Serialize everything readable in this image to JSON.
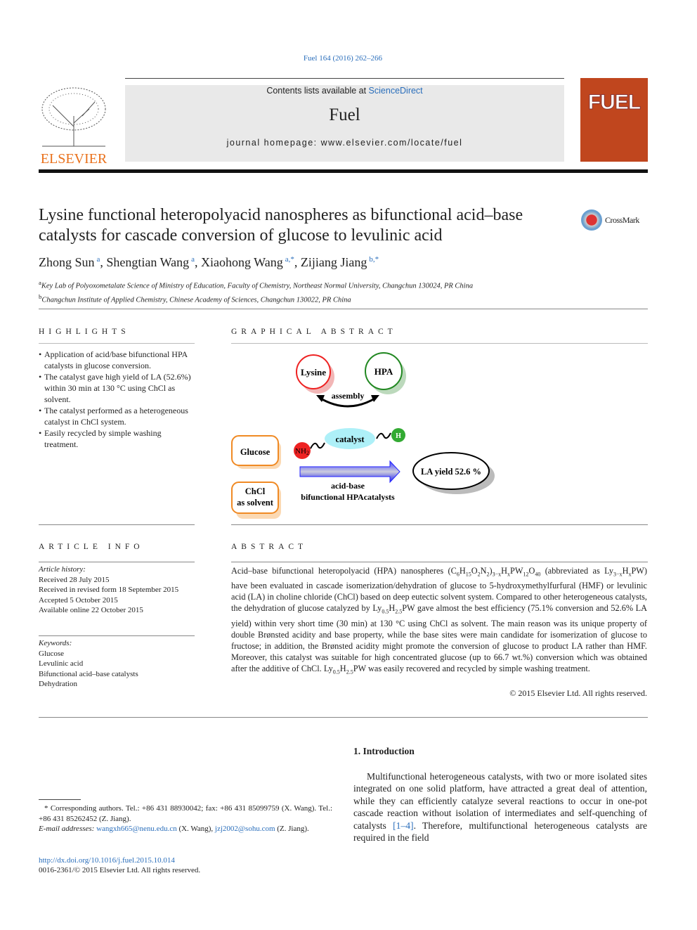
{
  "journal_ref": "Fuel 164 (2016) 262–266",
  "header": {
    "contents_prefix": "Contents lists available at ",
    "sciencedirect": "ScienceDirect",
    "journal": "Fuel",
    "homepage": "journal homepage: www.elsevier.com/locate/fuel",
    "publisher": "ELSEVIER",
    "cover_title": "FUEL"
  },
  "title": "Lysine functional heteropolyacid nanospheres as bifunctional acid–base catalysts for cascade conversion of glucose to levulinic acid",
  "crossmark": "CrossMark",
  "authors": [
    {
      "name": "Zhong Sun",
      "sup": "a"
    },
    {
      "name": "Shengtian Wang",
      "sup": "a"
    },
    {
      "name": "Xiaohong Wang",
      "sup": "a,*"
    },
    {
      "name": "Zijiang Jiang",
      "sup": "b,*"
    }
  ],
  "affiliations": [
    {
      "sup": "a",
      "text": "Key Lab of Polyoxometalate Science of Ministry of Education, Faculty of Chemistry, Northeast Normal University, Changchun 130024, PR China"
    },
    {
      "sup": "b",
      "text": "Changchun Institute of Applied Chemistry, Chinese Academy of Sciences, Changchun 130022, PR China"
    }
  ],
  "highlights": {
    "heading": "HIGHLIGHTS",
    "items": [
      "Application of acid/base bifunctional HPA catalysts in glucose conversion.",
      "The catalyst gave high yield of LA (52.6%) within 30 min at 130 °C using ChCl as solvent.",
      "The catalyst performed as a heterogeneous catalyst in ChCl system.",
      "Easily recycled by simple washing treatment."
    ]
  },
  "graphical_abstract": {
    "heading": "GRAPHICAL ABSTRACT",
    "lysine": "Lysine",
    "hpa": "HPA",
    "assembly": "assembly",
    "catalyst": "catalyst",
    "nh2": "NH",
    "nh2_sub": "2",
    "h": "H",
    "glucose": "Glucose",
    "chcl": "ChCl",
    "as_solvent": "as solvent",
    "acid_base": "acid-base",
    "bifunctional": "bifunctional HPAcatalysts",
    "la_yield": "LA yield 52.6 %"
  },
  "article_info": {
    "heading": "ARTICLE INFO",
    "history_label": "Article history:",
    "history": [
      "Received 28 July 2015",
      "Received in revised form 18 September 2015",
      "Accepted 5 October 2015",
      "Available online 22 October 2015"
    ],
    "keywords_label": "Keywords:",
    "keywords": [
      "Glucose",
      "Levulinic acid",
      "Bifunctional acid–base catalysts",
      "Dehydration"
    ]
  },
  "abstract": {
    "heading": "ABSTRACT",
    "segments": [
      [
        "Acid–base bifunctional heteropolyacid (HPA) nanospheres (C",
        0
      ],
      [
        "6",
        1
      ],
      [
        "H",
        0
      ],
      [
        "15",
        1
      ],
      [
        "O",
        0
      ],
      [
        "2",
        1
      ],
      [
        "N",
        0
      ],
      [
        "2",
        1
      ],
      [
        ")",
        0
      ],
      [
        "3−x",
        1
      ],
      [
        "H",
        0
      ],
      [
        "x",
        1
      ],
      [
        "PW",
        0
      ],
      [
        "12",
        1
      ],
      [
        "O",
        0
      ],
      [
        "40",
        1
      ],
      [
        " (abbreviated as Ly",
        0
      ],
      [
        "3−x",
        1
      ],
      [
        "H",
        0
      ],
      [
        "x",
        1
      ],
      [
        "PW) have been evaluated in cascade isomerization/dehydration of glucose to 5-hydroxymethylfurfural (HMF) or levulinic acid (LA) in choline chloride (ChCl) based on deep eutectic solvent system. Compared to other heterogeneous catalysts, the dehydration of glucose catalyzed by Ly",
        0
      ],
      [
        "0.5",
        1
      ],
      [
        "H",
        0
      ],
      [
        "2.5",
        1
      ],
      [
        "PW gave almost the best efficiency (75.1% conversion and 52.6% LA yield) within very short time (30 min) at 130 °C using ChCl as solvent. The main reason was its unique property of double Brønsted acidity and base property, while the base sites were main candidate for isomerization of glucose to fructose; in addition, the Brønsted acidity might promote the conversion of glucose to product LA rather than HMF. Moreover, this catalyst was suitable for high concentrated glucose (up to 66.7 wt.%) conversion which was obtained after the additive of ChCl. Ly",
        0
      ],
      [
        "0.5",
        1
      ],
      [
        "H",
        0
      ],
      [
        "2.5",
        1
      ],
      [
        "PW was easily recovered and recycled by simple washing treatment.",
        0
      ]
    ],
    "copyright": "© 2015 Elsevier Ltd. All rights reserved."
  },
  "intro": {
    "heading": "1. Introduction",
    "text_before": "Multifunctional heterogeneous catalysts, with two or more isolated sites integrated on one solid platform, have attracted a great deal of attention, while they can efficiently catalyze several reactions to occur in one-pot cascade reaction without isolation of intermediates and self-quenching of catalysts ",
    "ref": "[1–4]",
    "text_after": ". Therefore, multifunctional heterogeneous catalysts are required in the field"
  },
  "footnote": {
    "text1": "* Corresponding authors. Tel.: +86 431 88930042; fax: +86 431 85099759 (X. Wang). Tel.: +86 431 85262452 (Z. Jiang).",
    "email_label": "E-mail addresses: ",
    "email1": "wangxh665@nenu.edu.cn",
    "email1_who": " (X. Wang), ",
    "email2": "jzj2002@sohu.com",
    "email2_who": " (Z. Jiang)."
  },
  "doi": "http://dx.doi.org/10.1016/j.fuel.2015.10.014",
  "issn": "0016-2361/© 2015 Elsevier Ltd. All rights reserved."
}
